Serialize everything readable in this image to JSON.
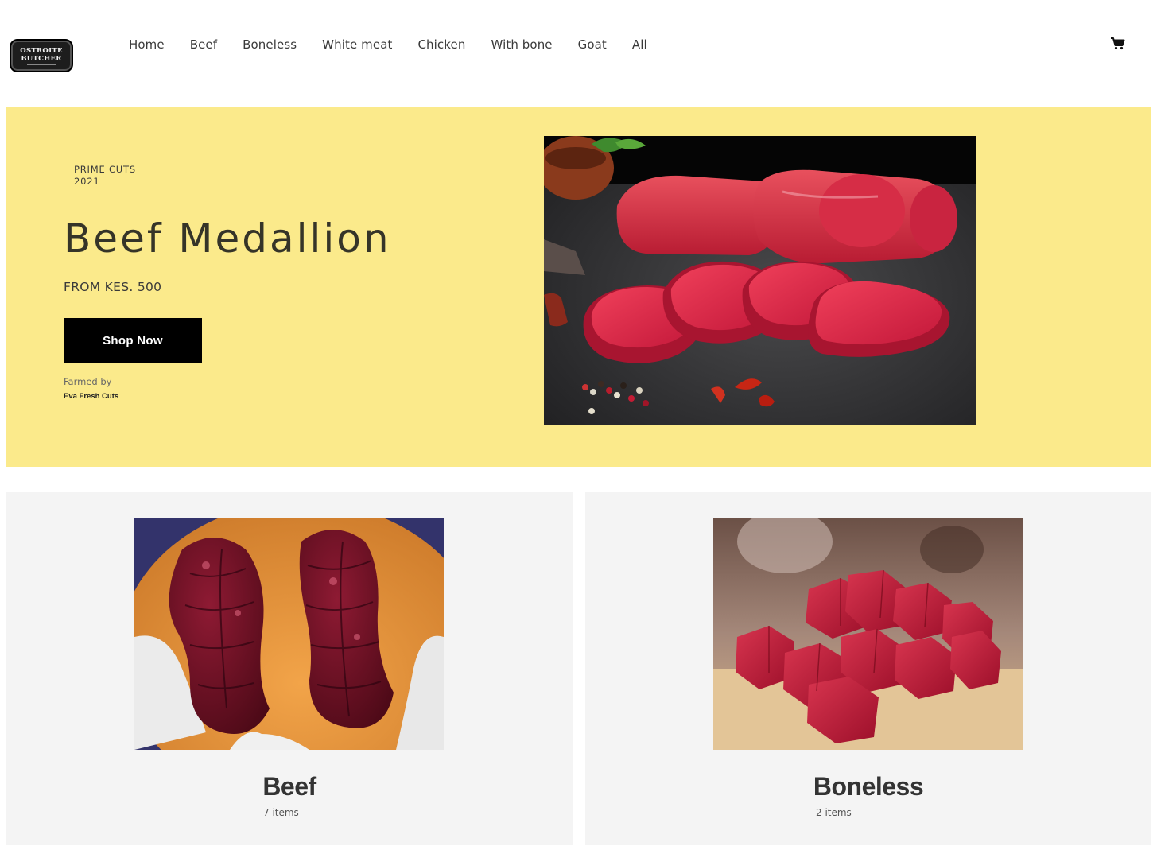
{
  "brand": {
    "logo_line1": "OSTROITE",
    "logo_line2": "BUTCHER"
  },
  "nav": {
    "items": [
      "Home",
      "Beef",
      "Boneless",
      "White meat",
      "Chicken",
      "With bone",
      "Goat",
      "All"
    ]
  },
  "icons": {
    "cart": "shopping-cart-icon"
  },
  "hero": {
    "tag_line1": "PRIME CUTS",
    "tag_line2": "2021",
    "title": "Beef Medallion",
    "price": "FROM KES. 500",
    "cta_label": "Shop Now",
    "farmed_label": "Farmed by",
    "farmed_name": "Eva Fresh Cuts",
    "background": "#fbea8b"
  },
  "categories": [
    {
      "title": "Beef",
      "count": "7 items"
    },
    {
      "title": "Boneless",
      "count": "2 items"
    }
  ]
}
